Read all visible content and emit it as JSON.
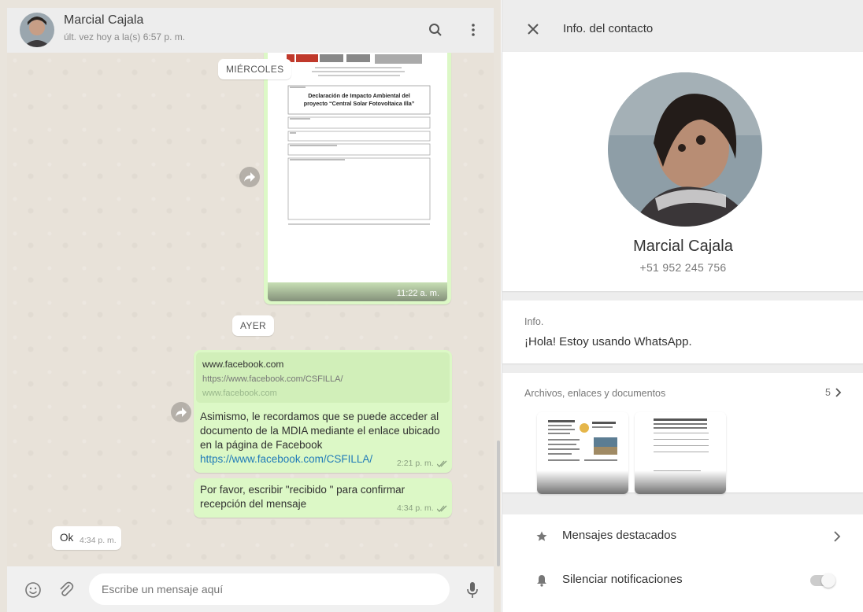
{
  "chat": {
    "contact_name": "Marcial Cajala",
    "last_seen": "últ. vez hoy a la(s) 6:57 p. m.",
    "date_separators": [
      "MIÉRCOLES",
      "AYER"
    ],
    "document": {
      "title_line1": "Declaración de Impacto Ambiental del",
      "title_line2": "proyecto “Central Solar Fotovoltaica Illa”",
      "time": "11:22 a. m."
    },
    "messages": {
      "link_preview": {
        "title": "www.facebook.com",
        "url": "https://www.facebook.com/CSFILLA/",
        "host": "www.facebook.com"
      },
      "msg1_text": "Asimismo, le recordamos que se puede acceder al documento de la MDIA mediante el enlace ubicado en la página de Facebook",
      "msg1_link": "https://www.facebook.com/CSFILLA/",
      "msg1_time": "2:21 p. m.",
      "msg2_text": "Por favor, escribir \"recibido \" para confirmar recepción del mensaje",
      "msg2_time": "4:34 p. m.",
      "incoming_text": "Ok",
      "incoming_time": "4:34 p. m."
    },
    "compose_placeholder": "Escribe un mensaje aquí"
  },
  "panel": {
    "title": "Info. del contacto",
    "name": "Marcial Cajala",
    "phone": "+51 952 245 756",
    "info_label": "Info.",
    "about": "¡Hola! Estoy usando WhatsApp.",
    "files_label": "Archivos, enlaces y documentos",
    "files_count": "5",
    "starred": "Mensajes destacados",
    "mute": "Silenciar notificaciones"
  },
  "colors": {
    "outgoing_bubble": "#dcf8c6",
    "incoming_bubble": "#ffffff",
    "chat_background": "#e8e2d9",
    "header_background": "#ededed",
    "link": "#1f7ab8"
  },
  "icons": [
    "search-icon",
    "menu-icon",
    "forward-icon",
    "emoji-icon",
    "attach-icon",
    "mic-icon",
    "close-icon",
    "star-icon",
    "bell-icon",
    "chevron-right-icon"
  ]
}
